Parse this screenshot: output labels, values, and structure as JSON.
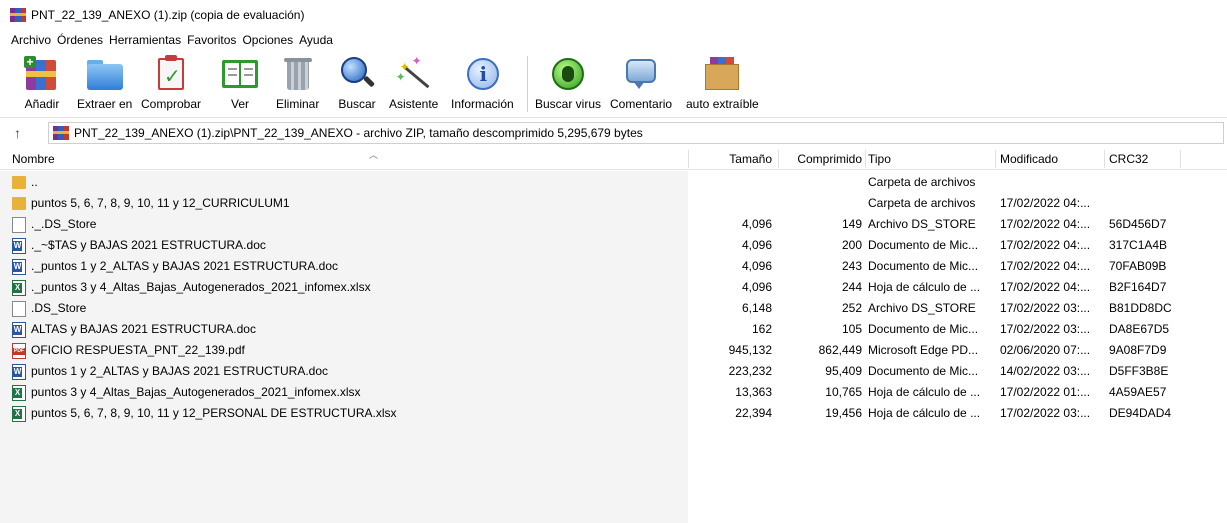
{
  "window": {
    "title": "PNT_22_139_ANEXO (1).zip (copia de evaluación)"
  },
  "menu": [
    "Archivo",
    "Órdenes",
    "Herramientas",
    "Favoritos",
    "Opciones",
    "Ayuda"
  ],
  "toolbar": {
    "add": "Añadir",
    "extract": "Extraer en",
    "test": "Comprobar",
    "view": "Ver",
    "delete": "Eliminar",
    "find": "Buscar",
    "wizard": "Asistente",
    "info": "Información",
    "virus": "Buscar virus",
    "comment": "Comentario",
    "sfx": "auto extraíble"
  },
  "address": {
    "path": "PNT_22_139_ANEXO (1).zip\\PNT_22_139_ANEXO - archivo ZIP, tamaño descomprimido 5,295,679 bytes"
  },
  "columns": {
    "name": "Nombre",
    "size": "Tamaño",
    "packed": "Comprimido",
    "type": "Tipo",
    "modified": "Modificado",
    "crc": "CRC32"
  },
  "files": [
    {
      "icon": "folder",
      "name": "..",
      "size": "",
      "packed": "",
      "type": "Carpeta de archivos",
      "modified": "",
      "crc": ""
    },
    {
      "icon": "folder",
      "name": "puntos 5, 6, 7, 8, 9, 10, 11 y 12_CURRICULUM1",
      "size": "",
      "packed": "",
      "type": "Carpeta de archivos",
      "modified": "17/02/2022 04:...",
      "crc": ""
    },
    {
      "icon": "blank",
      "name": "._.DS_Store",
      "size": "4,096",
      "packed": "149",
      "type": "Archivo DS_STORE",
      "modified": "17/02/2022 04:...",
      "crc": "56D456D7"
    },
    {
      "icon": "word",
      "name": "._~$TAS y BAJAS 2021 ESTRUCTURA.doc",
      "size": "4,096",
      "packed": "200",
      "type": "Documento de Mic...",
      "modified": "17/02/2022 04:...",
      "crc": "317C1A4B"
    },
    {
      "icon": "word",
      "name": "._puntos 1 y 2_ALTAS y BAJAS 2021 ESTRUCTURA.doc",
      "size": "4,096",
      "packed": "243",
      "type": "Documento de Mic...",
      "modified": "17/02/2022 04:...",
      "crc": "70FAB09B"
    },
    {
      "icon": "excel",
      "name": "._puntos 3 y 4_Altas_Bajas_Autogenerados_2021_infomex.xlsx",
      "size": "4,096",
      "packed": "244",
      "type": "Hoja de cálculo de ...",
      "modified": "17/02/2022 04:...",
      "crc": "B2F164D7"
    },
    {
      "icon": "blank",
      "name": ".DS_Store",
      "size": "6,148",
      "packed": "252",
      "type": "Archivo DS_STORE",
      "modified": "17/02/2022 03:...",
      "crc": "B81DD8DC"
    },
    {
      "icon": "word",
      "name": "ALTAS y BAJAS 2021 ESTRUCTURA.doc",
      "size": "162",
      "packed": "105",
      "type": "Documento de Mic...",
      "modified": "17/02/2022 03:...",
      "crc": "DA8E67D5"
    },
    {
      "icon": "pdf",
      "name": "OFICIO RESPUESTA_PNT_22_139.pdf",
      "size": "945,132",
      "packed": "862,449",
      "type": "Microsoft Edge PD...",
      "modified": "02/06/2020 07:...",
      "crc": "9A08F7D9"
    },
    {
      "icon": "word",
      "name": "puntos 1 y 2_ALTAS y BAJAS 2021 ESTRUCTURA.doc",
      "size": "223,232",
      "packed": "95,409",
      "type": "Documento de Mic...",
      "modified": "14/02/2022 03:...",
      "crc": "D5FF3B8E"
    },
    {
      "icon": "excel",
      "name": "puntos 3 y 4_Altas_Bajas_Autogenerados_2021_infomex.xlsx",
      "size": "13,363",
      "packed": "10,765",
      "type": "Hoja de cálculo de ...",
      "modified": "17/02/2022 01:...",
      "crc": "4A59AE57"
    },
    {
      "icon": "excel",
      "name": "puntos 5, 6, 7, 8, 9, 10, 11 y 12_PERSONAL DE ESTRUCTURA.xlsx",
      "size": "22,394",
      "packed": "19,456",
      "type": "Hoja de cálculo de ...",
      "modified": "17/02/2022 03:...",
      "crc": "DE94DAD4"
    }
  ]
}
